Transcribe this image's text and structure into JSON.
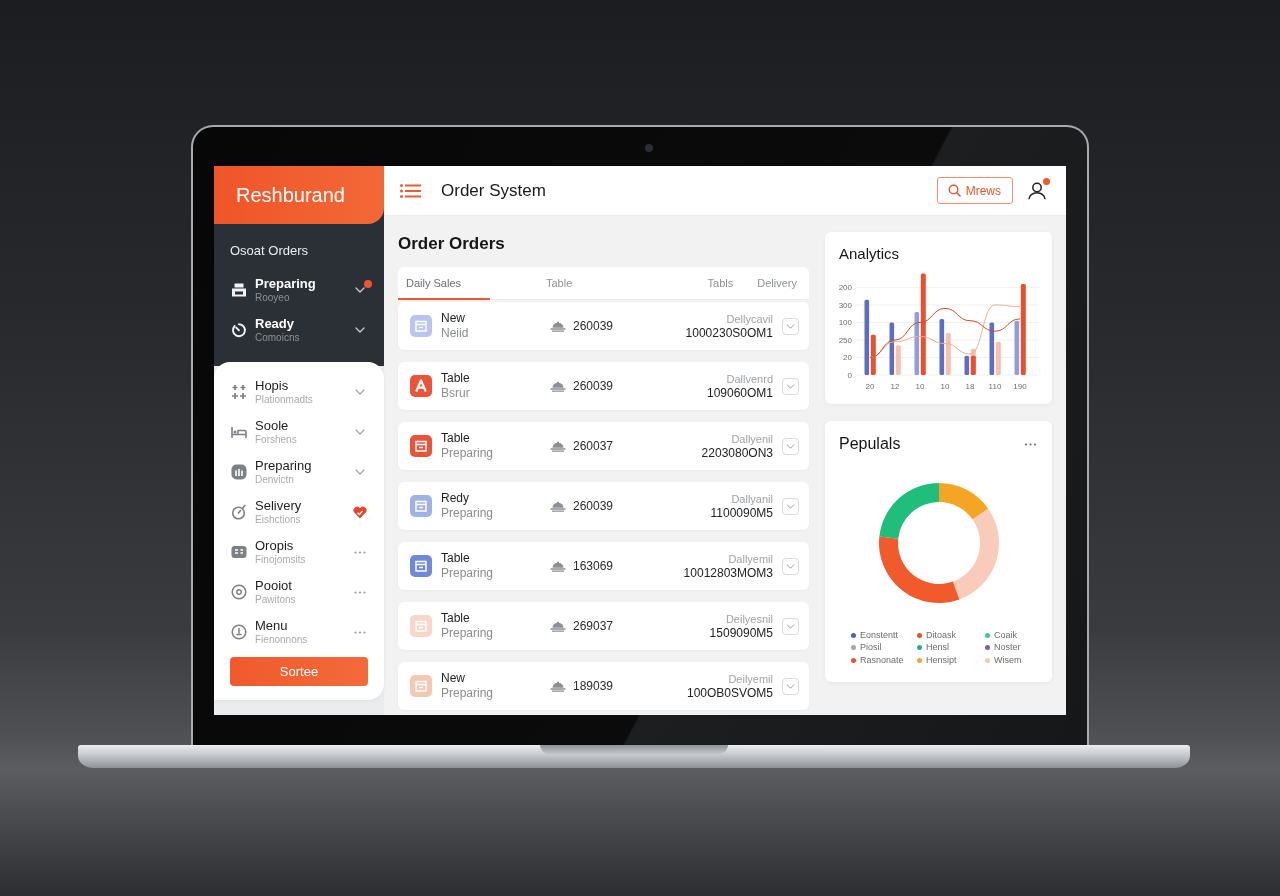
{
  "sidebar": {
    "brand": "Reshburand",
    "section_title": "Osoat Orders",
    "items": [
      {
        "label": "Preparing",
        "sub": "Rooyeo",
        "kind": "chevron",
        "badge": true
      },
      {
        "label": "Ready",
        "sub": "Comoicns",
        "kind": "chevron",
        "badge": false
      }
    ],
    "panel_items": [
      {
        "label": "Hopis",
        "sub": "Plationmadts",
        "kind": "chevron"
      },
      {
        "label": "Soole",
        "sub": "Forshens",
        "kind": "chevron"
      },
      {
        "label": "Preparing",
        "sub": "Denvictn",
        "kind": "chevron"
      },
      {
        "label": "Selivery",
        "sub": "Eishctions",
        "kind": "alert"
      },
      {
        "label": "Oropis",
        "sub": "Finojomsits",
        "kind": "more"
      },
      {
        "label": "Pooiot",
        "sub": "Pawitons",
        "kind": "more"
      },
      {
        "label": "Menu",
        "sub": "Fienonnons",
        "kind": "more"
      }
    ],
    "button": "Sortee"
  },
  "header": {
    "title": "Order System",
    "search_button": "Mrews",
    "notification": true
  },
  "orders": {
    "title": "Order Orders",
    "tabs": [
      {
        "label": "Daily Sales",
        "selected": true
      },
      {
        "label": "Table",
        "selected": false
      },
      {
        "label": "Tabls",
        "selected": false
      },
      {
        "label": "Delivery",
        "selected": false
      }
    ],
    "rows": [
      {
        "title": "New",
        "sub": "Neiid",
        "number": "260039",
        "label": "Dellycavil",
        "code": "1000230S0OM1",
        "color": "#b9c5ec",
        "kind": "box"
      },
      {
        "title": "Table",
        "sub": "Bsrur",
        "number": "260039",
        "label": "Dallvenrd",
        "code": "109060OM1",
        "color": "#e9543a",
        "kind": "arrow"
      },
      {
        "title": "Table",
        "sub": "Preparing",
        "number": "260037",
        "label": "Dallyenil",
        "code": "2203080ON3",
        "color": "#e8533a",
        "kind": "box"
      },
      {
        "title": "Redy",
        "sub": "Preparing",
        "number": "260039",
        "label": "Dallyanil",
        "code": "1100090M5",
        "color": "#9fb1e6",
        "kind": "box"
      },
      {
        "title": "Table",
        "sub": "Preparing",
        "number": "163069",
        "label": "Dallyemil",
        "code": "10012803MOM3",
        "color": "#6f88d8",
        "kind": "box"
      },
      {
        "title": "Table",
        "sub": "Preparing",
        "number": "269037",
        "label": "Deilyesnil",
        "code": "1509090M5",
        "color": "#f8d6c8",
        "kind": "box"
      },
      {
        "title": "New",
        "sub": "Preparing",
        "number": "189039",
        "label": "Deilyemil",
        "code": "100OB0SVOM5",
        "color": "#f6c7b2",
        "kind": "box"
      }
    ]
  },
  "analytics": {
    "title": "Analytics",
    "y_axis_labels": [
      "200",
      "300",
      "100",
      "250",
      "20",
      "0"
    ],
    "x_axis_labels": [
      "20",
      "12",
      "10",
      "10",
      "18",
      "110",
      "190"
    ]
  },
  "popular": {
    "title": "Pepulals",
    "legend": [
      {
        "label": "Eonstentt",
        "color": "#4f63b8"
      },
      {
        "label": "Ditoask",
        "color": "#e2542c"
      },
      {
        "label": "Coaik",
        "color": "#3cc79a"
      },
      {
        "label": "Piosil",
        "color": "#a5a5a5"
      },
      {
        "label": "Hensl",
        "color": "#1fb57a"
      },
      {
        "label": "Noster",
        "color": "#7d62a3"
      },
      {
        "label": "Rasnonate",
        "color": "#e8532a"
      },
      {
        "label": "Hensipt",
        "color": "#f2a32a"
      },
      {
        "label": "Wisem",
        "color": "#f3c6b4"
      }
    ]
  }
}
